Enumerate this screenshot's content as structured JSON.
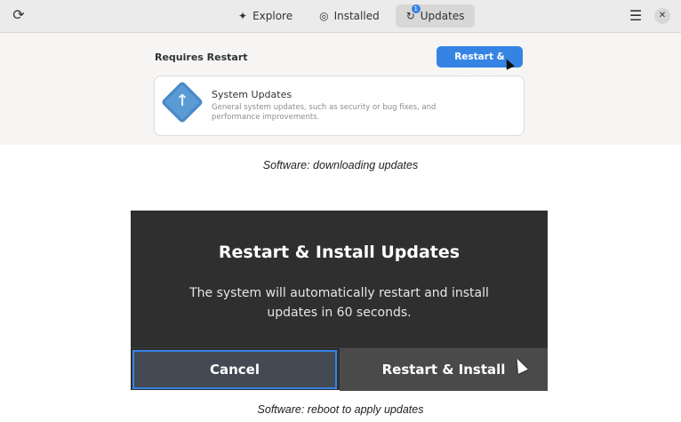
{
  "software": {
    "tabs": [
      {
        "label": "Explore",
        "icon": "star-icon"
      },
      {
        "label": "Installed",
        "icon": "check-circle-icon"
      },
      {
        "label": "Updates",
        "icon": "refresh-icon",
        "badge": "1",
        "active": true
      }
    ],
    "section_title": "Requires Restart",
    "restart_update_label": "Restart & Update",
    "update_item": {
      "title": "System Updates",
      "description": "General system updates, such as security or bug fixes, and performance improvements."
    }
  },
  "captions": {
    "first": "Software: downloading updates",
    "second": "Software: reboot to apply updates"
  },
  "dialog": {
    "title": "Restart & Install Updates",
    "body": "The system will automatically restart and install updates in 60 seconds.",
    "cancel_label": "Cancel",
    "confirm_label": "Restart & Install"
  },
  "colors": {
    "accent": "#3584e4",
    "dialog_bg": "#2f2f2f"
  }
}
